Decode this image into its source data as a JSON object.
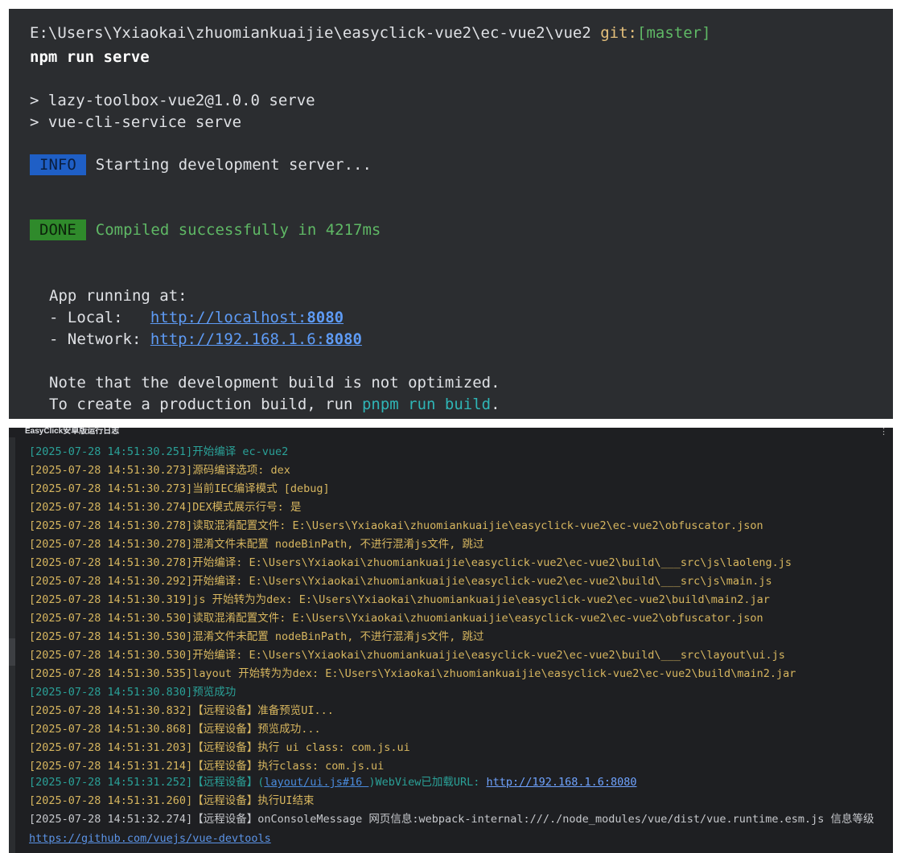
{
  "terminal": {
    "prompt_path": "E:\\Users\\Yxiaokai\\zhuomiankuaijie\\easyclick-vue2\\ec-vue2\\vue2",
    "prompt_git": "git:",
    "prompt_branch": "[master]",
    "command": "npm run serve",
    "script_line1": "> lazy-toolbox-vue2@1.0.0 serve",
    "script_line2": "> vue-cli-service serve",
    "info_badge": "INFO",
    "info_text": "Starting development server...",
    "done_badge": "DONE",
    "done_text": "Compiled successfully in 4217ms",
    "app_running": "App running at:",
    "local_label": "- Local:   ",
    "local_url_prefix": "http://localhost:",
    "local_url_port": "8080",
    "network_label": "- Network: ",
    "network_url_prefix": "http://192.168.1.6:",
    "network_url_port": "8080",
    "note_line1": "Note that the development build is not optimized.",
    "note_line2_prefix": "To create a production build, run ",
    "note_line2_cmd": "pnpm run build",
    "note_line2_suffix": "."
  },
  "log": {
    "title": "EasyClick安卓版运行日志",
    "menu_icon": "⋮",
    "lines": [
      {
        "text": "[2025-07-28 14:51:30.251]开始编译 ec-vue2",
        "style": "teal"
      },
      {
        "text": "[2025-07-28 14:51:30.273]源码编译选项: dex",
        "style": "yellow"
      },
      {
        "text": "[2025-07-28 14:51:30.273]当前IEC编译模式 [debug]",
        "style": "yellow"
      },
      {
        "text": "[2025-07-28 14:51:30.274]DEX模式展示行号: 是",
        "style": "yellow"
      },
      {
        "text": "[2025-07-28 14:51:30.278]读取混淆配置文件: E:\\Users\\Yxiaokai\\zhuomiankuaijie\\easyclick-vue2\\ec-vue2\\obfuscator.json",
        "style": "yellow"
      },
      {
        "text": "[2025-07-28 14:51:30.278]混淆文件未配置 nodeBinPath, 不进行混淆js文件, 跳过",
        "style": "yellow"
      },
      {
        "text": "[2025-07-28 14:51:30.278]开始编译: E:\\Users\\Yxiaokai\\zhuomiankuaijie\\easyclick-vue2\\ec-vue2\\build\\___src\\js\\laoleng.js",
        "style": "yellow"
      },
      {
        "text": "[2025-07-28 14:51:30.292]开始编译: E:\\Users\\Yxiaokai\\zhuomiankuaijie\\easyclick-vue2\\ec-vue2\\build\\___src\\js\\main.js",
        "style": "yellow"
      },
      {
        "text": "[2025-07-28 14:51:30.319]js 开始转为为dex: E:\\Users\\Yxiaokai\\zhuomiankuaijie\\easyclick-vue2\\ec-vue2\\build\\main2.jar",
        "style": "yellow"
      },
      {
        "text": "[2025-07-28 14:51:30.530]读取混淆配置文件: E:\\Users\\Yxiaokai\\zhuomiankuaijie\\easyclick-vue2\\ec-vue2\\obfuscator.json",
        "style": "yellow"
      },
      {
        "text": "[2025-07-28 14:51:30.530]混淆文件未配置 nodeBinPath, 不进行混淆js文件, 跳过",
        "style": "yellow"
      },
      {
        "text": "[2025-07-28 14:51:30.530]开始编译: E:\\Users\\Yxiaokai\\zhuomiankuaijie\\easyclick-vue2\\ec-vue2\\build\\___src\\layout\\ui.js",
        "style": "yellow"
      },
      {
        "text": "[2025-07-28 14:51:30.535]layout 开始转为为dex: E:\\Users\\Yxiaokai\\zhuomiankuaijie\\easyclick-vue2\\ec-vue2\\build\\main2.jar",
        "style": "yellow"
      },
      {
        "text": "[2025-07-28 14:51:30.830]预览成功",
        "style": "teal"
      },
      {
        "text": "[2025-07-28 14:51:30.832]【远程设备】准备预览UI...",
        "style": "yellow"
      },
      {
        "text": "[2025-07-28 14:51:30.868]【远程设备】预览成功...",
        "style": "yellow"
      },
      {
        "text": "[2025-07-28 14:51:31.203]【远程设备】执行 ui class: com.js.ui",
        "style": "yellow"
      },
      {
        "text": "[2025-07-28 14:51:31.214]【远程设备】执行class: com.js.ui",
        "style": "yellow"
      }
    ],
    "webview_line": {
      "prefix": "[2025-07-28 14:51:31.252]【远程设备】(",
      "source_link": "layout/ui.js#16 ",
      "middle": ")WebView已加载URL: ",
      "url": "http://192.168.1.6:8080"
    },
    "end_line": "[2025-07-28 14:51:31.260]【远程设备】执行UI结束",
    "console_line": "[2025-07-28 14:51:32.274]【远程设备】onConsoleMessage 网页信息:webpack-internal:///./node_modules/vue/dist/vue.runtime.esm.js 信息等级",
    "devtools_url": "https://github.com/vuejs/vue-devtools"
  }
}
